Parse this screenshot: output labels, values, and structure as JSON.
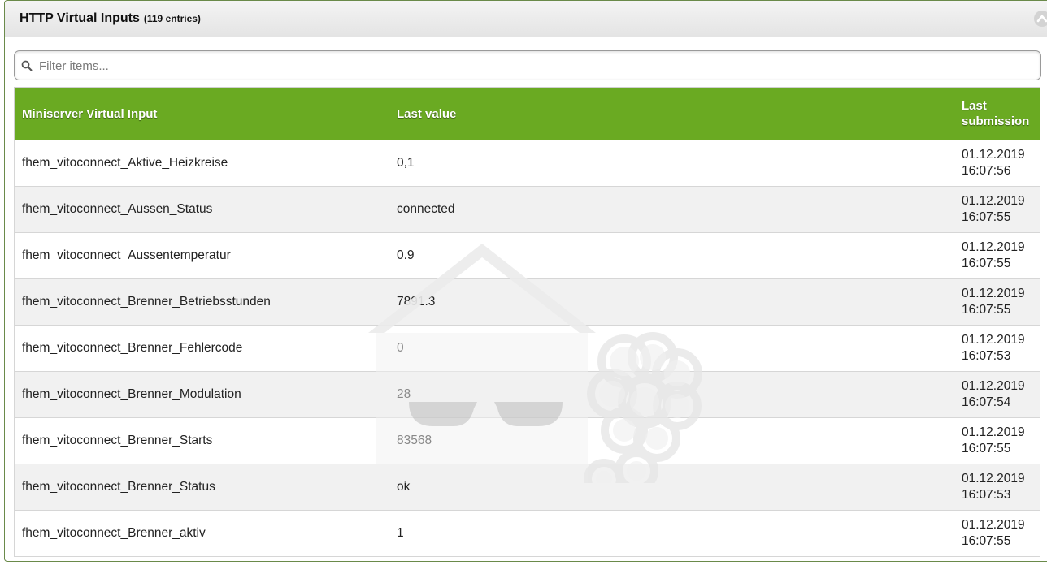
{
  "panel": {
    "title": "HTTP Virtual Inputs",
    "count": "(119 entries)",
    "accent_color": "#6aaa22"
  },
  "search": {
    "placeholder": "Filter items...",
    "value": ""
  },
  "table": {
    "headers": {
      "input": "Miniserver Virtual Input",
      "value": "Last value",
      "submission": "Last submission"
    },
    "rows": [
      {
        "name": "fhem_vitoconnect_Aktive_Heizkreise",
        "value": "0,1",
        "date": "01.12.2019",
        "time": "16:07:56"
      },
      {
        "name": "fhem_vitoconnect_Aussen_Status",
        "value": "connected",
        "date": "01.12.2019",
        "time": "16:07:55"
      },
      {
        "name": "fhem_vitoconnect_Aussentemperatur",
        "value": "0.9",
        "date": "01.12.2019",
        "time": "16:07:55"
      },
      {
        "name": "fhem_vitoconnect_Brenner_Betriebsstunden",
        "value": "7891.3",
        "date": "01.12.2019",
        "time": "16:07:55"
      },
      {
        "name": "fhem_vitoconnect_Brenner_Fehlercode",
        "value": "0",
        "date": "01.12.2019",
        "time": "16:07:53"
      },
      {
        "name": "fhem_vitoconnect_Brenner_Modulation",
        "value": "28",
        "date": "01.12.2019",
        "time": "16:07:54"
      },
      {
        "name": "fhem_vitoconnect_Brenner_Starts",
        "value": "83568",
        "date": "01.12.2019",
        "time": "16:07:55"
      },
      {
        "name": "fhem_vitoconnect_Brenner_Status",
        "value": "ok",
        "date": "01.12.2019",
        "time": "16:07:53"
      },
      {
        "name": "fhem_vitoconnect_Brenner_aktiv",
        "value": "1",
        "date": "01.12.2019",
        "time": "16:07:55"
      }
    ]
  }
}
